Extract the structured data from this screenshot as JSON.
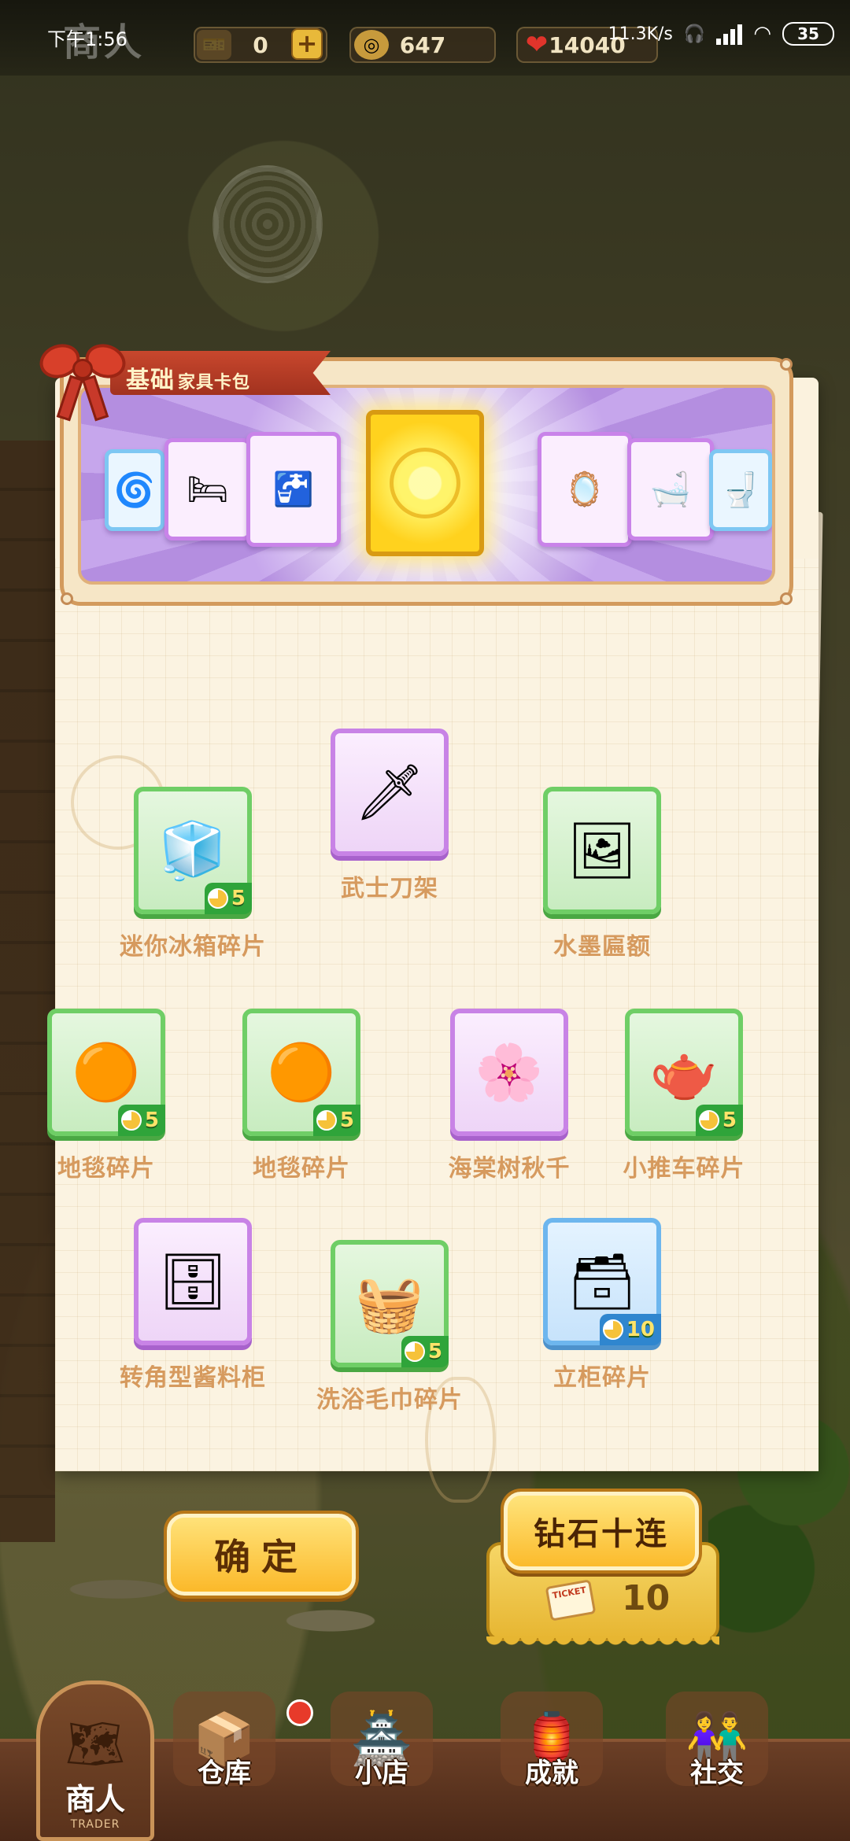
{
  "status_bar": {
    "time": "下午1:56",
    "network_speed": "11.3K/s",
    "battery": "35"
  },
  "header": {
    "logo": "商人",
    "resources": [
      {
        "name": "ticket",
        "icon": "ticket-icon",
        "value": "0"
      },
      {
        "name": "coins",
        "icon": "coin-icon",
        "value": "647"
      },
      {
        "name": "hearts",
        "icon": "heart-icon",
        "value": "14040"
      }
    ],
    "plus_label": "+"
  },
  "card_pack": {
    "title": "基础",
    "subtitle": "家具卡包",
    "cards": [
      {
        "type": "blue",
        "icon": "fan-icon"
      },
      {
        "type": "purple",
        "icon": "bed-icon"
      },
      {
        "type": "purple",
        "icon": "sink-cabinet-icon"
      },
      {
        "type": "gold",
        "icon": "flower-emblem-icon"
      },
      {
        "type": "purple",
        "icon": "vanity-desk-icon"
      },
      {
        "type": "purple",
        "icon": "bathtub-icon"
      },
      {
        "type": "blue",
        "icon": "toilet-icon"
      }
    ]
  },
  "rewards": [
    {
      "label": "迷你冰箱碎片",
      "rarity": "green",
      "icon": "mini-fridge-icon",
      "glyph": "🧊",
      "count": "5"
    },
    {
      "label": "武士刀架",
      "rarity": "purple",
      "icon": "katana-rack-icon",
      "glyph": "🗡",
      "count": ""
    },
    {
      "label": "水墨匾额",
      "rarity": "green",
      "icon": "ink-plaque-icon",
      "glyph": "🖼",
      "count": ""
    },
    {
      "label": "地毯碎片",
      "rarity": "green",
      "icon": "rug-icon",
      "glyph": "🟠",
      "count": "5"
    },
    {
      "label": "地毯碎片",
      "rarity": "green",
      "icon": "rug-icon",
      "glyph": "🟠",
      "count": "5"
    },
    {
      "label": "海棠树秋千",
      "rarity": "purple",
      "icon": "begonia-swing-icon",
      "glyph": "🌸",
      "count": ""
    },
    {
      "label": "小推车碎片",
      "rarity": "green",
      "icon": "cart-icon",
      "glyph": "🫖",
      "count": "5"
    },
    {
      "label": "转角型酱料柜",
      "rarity": "purple",
      "icon": "corner-cabinet-icon",
      "glyph": "🗄",
      "count": ""
    },
    {
      "label": "洗浴毛巾碎片",
      "rarity": "green",
      "icon": "towel-icon",
      "glyph": "🧺",
      "count": "5"
    },
    {
      "label": "立柜碎片",
      "rarity": "blue",
      "icon": "dresser-icon",
      "glyph": "🗃",
      "count": "10"
    }
  ],
  "actions": {
    "confirm_label": "确定",
    "diamond_ten_label": "钻石十连",
    "ticket_label": "TICKET",
    "ticket_cost": "10"
  },
  "bottom_nav": {
    "active": {
      "label": "商人",
      "sub": "TRADER"
    },
    "items": [
      {
        "label": "仓库",
        "icon": "warehouse-icon",
        "glyph": "📦"
      },
      {
        "label": "小店",
        "icon": "shop-icon",
        "glyph": "🏯"
      },
      {
        "label": "成就",
        "icon": "achievement-icon",
        "glyph": "🏮"
      },
      {
        "label": "社交",
        "icon": "social-icon",
        "glyph": "👫"
      }
    ]
  }
}
